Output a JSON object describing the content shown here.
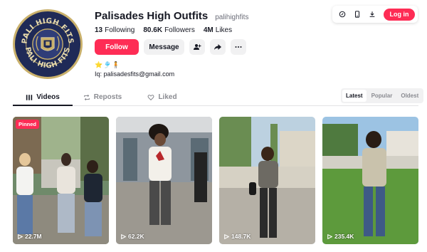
{
  "profile": {
    "display_name": "Palisades High Outfits",
    "handle": "palihighfits",
    "avatar_text_top": "PALI HIGH FITS",
    "avatar_text_bottom": "PALI HIGH FITS",
    "emoji_line": "⭐🎐🧍",
    "bio": "Iq: palisadesfits@gmail.com"
  },
  "stats": [
    {
      "value": "13",
      "label": "Following"
    },
    {
      "value": "80.6K",
      "label": "Followers"
    },
    {
      "value": "4M",
      "label": "Likes"
    }
  ],
  "actions": {
    "follow_label": "Follow",
    "message_label": "Message",
    "icons": [
      "add-friend-icon",
      "share-icon",
      "more-icon"
    ]
  },
  "topbar": {
    "icons": [
      "coin-icon",
      "phone-icon",
      "download-icon"
    ],
    "login_label": "Log in"
  },
  "tabs": [
    {
      "label": "Videos",
      "icon": "grid-icon",
      "active": true
    },
    {
      "label": "Reposts",
      "icon": "repost-icon",
      "active": false
    },
    {
      "label": "Liked",
      "icon": "heart-icon",
      "active": false
    }
  ],
  "sort_options": [
    {
      "label": "Latest",
      "active": true
    },
    {
      "label": "Popular",
      "active": false
    },
    {
      "label": "Oldest",
      "active": false
    }
  ],
  "videos": [
    {
      "views": "22.7M",
      "pinned": true,
      "pinned_label": "Pinned"
    },
    {
      "views": "62.2K",
      "pinned": false
    },
    {
      "views": "148.7K",
      "pinned": false
    },
    {
      "views": "235.4K",
      "pinned": false
    }
  ],
  "colors": {
    "accent": "#fe2c55",
    "text": "#161823",
    "muted": "#8a8b91",
    "avatar_bg": "#1f2a57",
    "avatar_gold": "#c9b06b"
  }
}
